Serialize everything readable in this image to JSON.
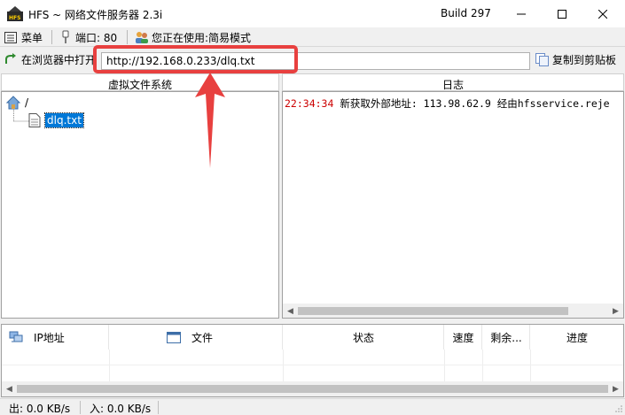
{
  "window": {
    "title": "HFS ~ 网络文件服务器 2.3i",
    "build": "Build 297"
  },
  "toolbar": {
    "menu_label": "菜单",
    "port_label": "端口: 80",
    "mode_label": "您正在使用:简易模式"
  },
  "url_bar": {
    "open_in_browser_label": "在浏览器中打开",
    "url_value": "http://192.168.0.233/dlq.txt",
    "copy_clipboard_label": "复制到剪贴板"
  },
  "vfs": {
    "header": "虚拟文件系统",
    "root_label": "/",
    "files": [
      "dlq.txt"
    ]
  },
  "log": {
    "header": "日志",
    "entries": [
      {
        "time": "22:34:34",
        "message": "新获取外部地址: 113.98.62.9 经由hfsservice.reje"
      }
    ]
  },
  "connections": {
    "columns": [
      "IP地址",
      "文件",
      "状态",
      "速度",
      "剩余...",
      "进度"
    ]
  },
  "status": {
    "out_label": "出: 0.0 KB/s",
    "in_label": "入: 0.0 KB/s"
  },
  "colors": {
    "annotation_red": "#e8403f",
    "selection_blue": "#0078d7",
    "log_time_red": "#cc0000"
  },
  "icons": [
    "hfs-app-icon",
    "menu-icon",
    "port-plug-icon",
    "users-icon",
    "open-browser-icon",
    "copy-clipboard-icon",
    "home-folder-icon",
    "file-icon",
    "network-ip-icon",
    "file-window-icon"
  ]
}
